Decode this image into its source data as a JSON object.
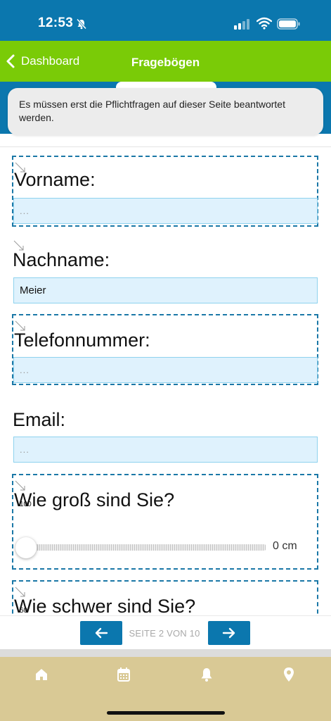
{
  "status_bar": {
    "time": "12:53"
  },
  "nav": {
    "back_label": "Dashboard",
    "title": "Fragebögen"
  },
  "toast": {
    "message": "Es müssen erst die Pflichtfragen auf dieser Seite beantwortet werden."
  },
  "questions": {
    "vorname": {
      "label": "Vorname:",
      "placeholder": "..."
    },
    "nachname": {
      "label": "Nachname:",
      "value": "Meier"
    },
    "telefon": {
      "label": "Telefonnummer:",
      "placeholder": "..."
    },
    "email": {
      "label": "Email:",
      "placeholder": "..."
    },
    "groesse": {
      "label": "Wie groß sind Sie?",
      "range_min": "100",
      "value_text": "0 cm",
      "value": 0
    },
    "gewicht": {
      "label": "Wie schwer sind Sie?",
      "range_min": "50"
    }
  },
  "pager": {
    "label": "SEITE 2 VON 10",
    "current_page": 2,
    "total_pages": 10
  },
  "tab_bar": {
    "items": [
      "home-icon",
      "calendar-icon",
      "bell-icon",
      "location-pin-icon"
    ]
  },
  "colors": {
    "status_blue": "#0B77AE",
    "nav_green": "#7ACB07",
    "input_bg": "#DFF2FD",
    "required_dashed": "#1B78A7",
    "tab_bar_bg": "#D9C995"
  }
}
